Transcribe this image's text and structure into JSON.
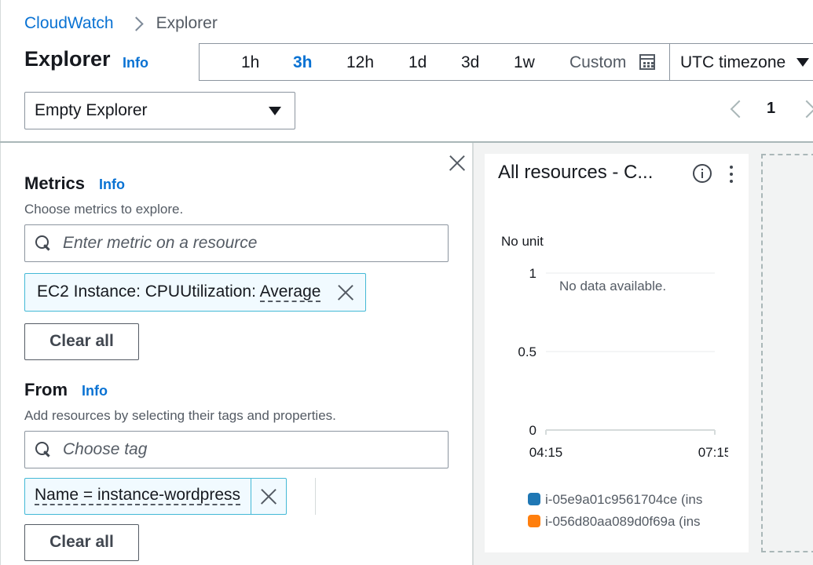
{
  "breadcrumb": {
    "root": "CloudWatch",
    "current": "Explorer"
  },
  "header": {
    "title": "Explorer",
    "info": "Info"
  },
  "time_range": {
    "options": [
      "1h",
      "3h",
      "12h",
      "1d",
      "3d",
      "1w"
    ],
    "selected": "3h",
    "custom_label": "Custom"
  },
  "timezone": {
    "value": "UTC timezone"
  },
  "explorer_select": {
    "value": "Empty Explorer"
  },
  "pagination": {
    "current_page": "1"
  },
  "metrics": {
    "title": "Metrics",
    "info": "Info",
    "description": "Choose metrics to explore.",
    "search_placeholder": "Enter metric on a resource",
    "token": {
      "prefix": "EC2 Instance: CPUUtilization: ",
      "stat": "Average"
    },
    "clear_label": "Clear all"
  },
  "from": {
    "title": "From",
    "info": "Info",
    "description": "Add resources by selecting their tags and properties.",
    "search_placeholder": "Choose tag",
    "token": "Name = instance-wordpress",
    "clear_label": "Clear all"
  },
  "widget": {
    "title": "All resources - C...",
    "unit": "No unit",
    "no_data": "No data available.",
    "chart_data": {
      "type": "line",
      "title": "All resources - C...",
      "ylabel": "No unit",
      "ylim": [
        0,
        1
      ],
      "yticks": [
        "1",
        "0.5",
        "0"
      ],
      "xticks": [
        "04:15",
        "07:15"
      ],
      "series": [
        {
          "name": "i-05e9a01c9561704ce (ins",
          "color": "#1f77b4",
          "values": []
        },
        {
          "name": "i-056d80aa089d0f69a (ins",
          "color": "#ff7f0e",
          "values": []
        }
      ],
      "annotation": "No data available."
    }
  },
  "colors": {
    "link": "#0972d3",
    "border": "#8c959f",
    "token_border": "#44b9d6"
  }
}
